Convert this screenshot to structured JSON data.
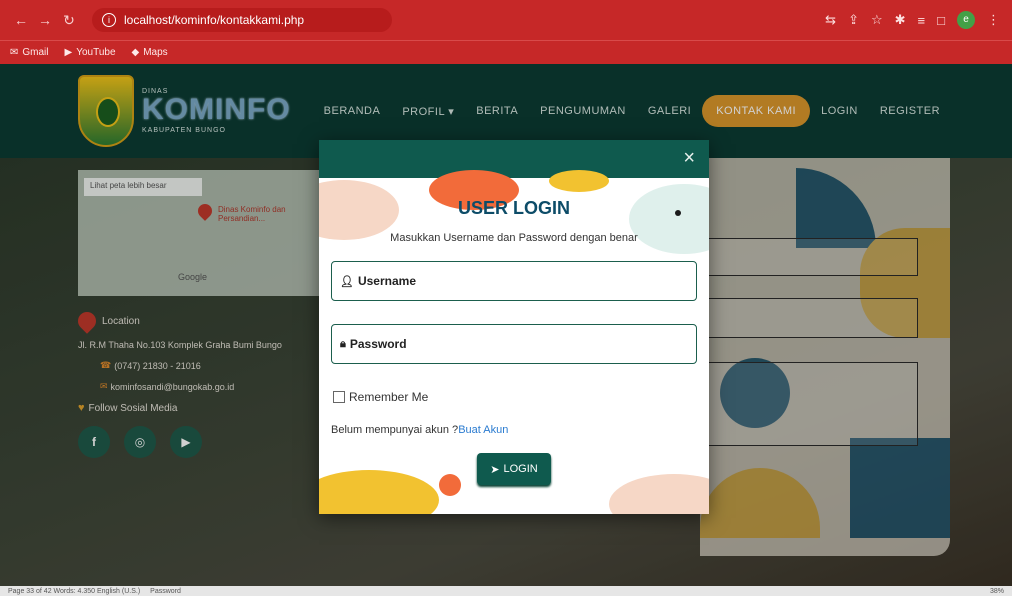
{
  "browser": {
    "url": "localhost/kominfo/kontakkami.php",
    "bookmarks": [
      "Gmail",
      "YouTube",
      "Maps"
    ],
    "profile_initial": "e"
  },
  "site": {
    "logo_small": "DINAS",
    "logo_name": "KOMINFO",
    "logo_sub": "KABUPATEN BUNGO",
    "nav": [
      "BERANDA",
      "PROFIL ▾",
      "BERITA",
      "PENGUMUMAN",
      "GALERI",
      "KONTAK KAMI",
      "LOGIN",
      "REGISTER"
    ],
    "active_nav": "KONTAK KAMI"
  },
  "map": {
    "search": "Lihat peta lebih besar",
    "place": "Dinas Kominfo dan Persandian...",
    "attribution": "Google"
  },
  "contact": {
    "location_label": "Location",
    "address": "Jl. R.M Thaha No.103 Komplek Graha Bumi Bungo",
    "phone": "(0747) 21830 - 21016",
    "email": "kominfosandi@bungokab.go.id",
    "follow_label": "Follow Sosial Media",
    "social": [
      "f",
      "◎",
      "▶"
    ]
  },
  "modal": {
    "title": "USER LOGIN",
    "subtitle": "Masukkan Username dan Password dengan benar",
    "username_label": "Username",
    "password_label": "Password",
    "remember_label": "Remember Me",
    "no_account_text": "Belum mempunyai akun ?",
    "create_account_link": "Buat Akun",
    "login_button": "LOGIN",
    "close_symbol": "×"
  },
  "statusbar": {
    "left": "Page 33 of 42   Words: 4.350   English (U.S.)",
    "mid": "Password",
    "zoom": "38%"
  },
  "colors": {
    "chrome_red": "#c62828",
    "header_green": "#0c3b33",
    "modal_green": "#0f5a4e",
    "active_orange": "#d9962b",
    "title_blue": "#0d4c68"
  }
}
